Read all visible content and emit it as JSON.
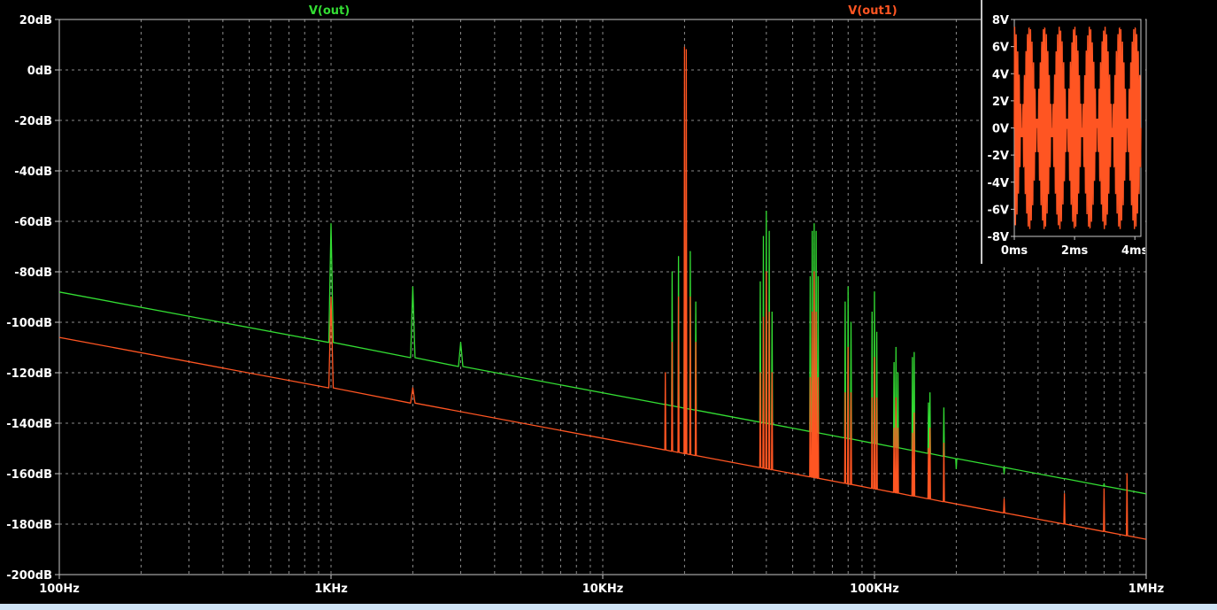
{
  "chart_data": [
    {
      "type": "line",
      "xscale": "log",
      "xlim": [
        100,
        1000000
      ],
      "ylim": [
        -200,
        20
      ],
      "x_ticks": [
        {
          "value": 100,
          "label": "100Hz"
        },
        {
          "value": 1000,
          "label": "1KHz"
        },
        {
          "value": 10000,
          "label": "10KHz"
        },
        {
          "value": 100000,
          "label": "100KHz"
        },
        {
          "value": 1000000,
          "label": "1MHz"
        }
      ],
      "y_ticks": [
        {
          "value": 20,
          "label": "20dB"
        },
        {
          "value": 0,
          "label": "0dB"
        },
        {
          "value": -20,
          "label": "-20dB"
        },
        {
          "value": -40,
          "label": "-40dB"
        },
        {
          "value": -60,
          "label": "-60dB"
        },
        {
          "value": -80,
          "label": "-80dB"
        },
        {
          "value": -100,
          "label": "-100dB"
        },
        {
          "value": -120,
          "label": "-120dB"
        },
        {
          "value": -140,
          "label": "-140dB"
        },
        {
          "value": -160,
          "label": "-160dB"
        },
        {
          "value": -180,
          "label": "-180dB"
        },
        {
          "value": -200,
          "label": "-200dB"
        }
      ],
      "grid": true,
      "series": [
        {
          "name": "V(out)",
          "color": "#33dd33",
          "baseline": [
            [
              100,
              -88
            ],
            [
              1000000,
              -168
            ]
          ],
          "peaks": [
            [
              1000,
              -61
            ],
            [
              2000,
              -86
            ],
            [
              3000,
              -108
            ],
            [
              17000,
              -132
            ],
            [
              18000,
              -80
            ],
            [
              19000,
              -74
            ],
            [
              20000,
              -62
            ],
            [
              21000,
              -72
            ],
            [
              22000,
              -92
            ],
            [
              38000,
              -84
            ],
            [
              39000,
              -66
            ],
            [
              40000,
              -56
            ],
            [
              41000,
              -64
            ],
            [
              42000,
              -96
            ],
            [
              58000,
              -82
            ],
            [
              59000,
              -64
            ],
            [
              60000,
              -61
            ],
            [
              61000,
              -64
            ],
            [
              62000,
              -82
            ],
            [
              78000,
              -92
            ],
            [
              80000,
              -86
            ],
            [
              82000,
              -100
            ],
            [
              98000,
              -96
            ],
            [
              100000,
              -88
            ],
            [
              102000,
              -104
            ],
            [
              118000,
              -116
            ],
            [
              120000,
              -110
            ],
            [
              122000,
              -120
            ],
            [
              138000,
              -114
            ],
            [
              140000,
              -112
            ],
            [
              158000,
              -132
            ],
            [
              160000,
              -128
            ],
            [
              180000,
              -134
            ],
            [
              200000,
              -158
            ],
            [
              300000,
              -160
            ],
            [
              500000,
              -162
            ],
            [
              700000,
              -164
            ]
          ]
        },
        {
          "name": "V(out1)",
          "color": "#ff5522",
          "baseline": [
            [
              100,
              -106
            ],
            [
              1000000,
              -186
            ]
          ],
          "peaks": [
            [
              1000,
              -90
            ],
            [
              2000,
              -126
            ],
            [
              17000,
              -120
            ],
            [
              18000,
              -108
            ],
            [
              19000,
              -90
            ],
            [
              20000,
              9
            ],
            [
              20300,
              8
            ],
            [
              21000,
              -90
            ],
            [
              22000,
              -108
            ],
            [
              38000,
              -120
            ],
            [
              39000,
              -98
            ],
            [
              40000,
              -80
            ],
            [
              41000,
              -96
            ],
            [
              42000,
              -120
            ],
            [
              58000,
              -122
            ],
            [
              59000,
              -96
            ],
            [
              60000,
              -80
            ],
            [
              61000,
              -96
            ],
            [
              62000,
              -122
            ],
            [
              78000,
              -128
            ],
            [
              80000,
              -110
            ],
            [
              82000,
              -128
            ],
            [
              98000,
              -130
            ],
            [
              100000,
              -114
            ],
            [
              102000,
              -130
            ],
            [
              118000,
              -142
            ],
            [
              120000,
              -130
            ],
            [
              122000,
              -142
            ],
            [
              138000,
              -144
            ],
            [
              140000,
              -136
            ],
            [
              158000,
              -150
            ],
            [
              160000,
              -142
            ],
            [
              180000,
              -148
            ],
            [
              300000,
              -170
            ],
            [
              500000,
              -168
            ],
            [
              700000,
              -166
            ],
            [
              850000,
              -160
            ]
          ]
        }
      ]
    },
    {
      "type": "line",
      "xlim": [
        0,
        4.2
      ],
      "ylim": [
        -8,
        8
      ],
      "x_ticks": [
        {
          "value": 0,
          "label": "0ms"
        },
        {
          "value": 2,
          "label": "2ms"
        },
        {
          "value": 4,
          "label": "4ms"
        }
      ],
      "y_ticks": [
        {
          "value": 8,
          "label": "8V"
        },
        {
          "value": 6,
          "label": "6V"
        },
        {
          "value": 4,
          "label": "4V"
        },
        {
          "value": 2,
          "label": "2V"
        },
        {
          "value": 0,
          "label": "0V"
        },
        {
          "value": -2,
          "label": "-2V"
        },
        {
          "value": -4,
          "label": "-4V"
        },
        {
          "value": -6,
          "label": "-6V"
        },
        {
          "value": -8,
          "label": "-8V"
        }
      ],
      "grid": false,
      "series": [
        {
          "color": "#ff5522",
          "envelope_amplitude": 7.5,
          "envelope_frequency_khz": 1,
          "carrier_frequency_khz": 20
        }
      ]
    }
  ]
}
